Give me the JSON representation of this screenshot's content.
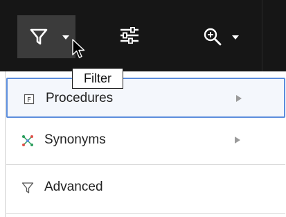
{
  "toolbar": {
    "buttons": [
      {
        "icon": "filter-icon",
        "has_dropdown": true,
        "selected": true
      },
      {
        "icon": "sliders-icon",
        "has_dropdown": false
      },
      {
        "icon": "zoom-icon",
        "has_dropdown": true
      }
    ],
    "background": "#161616",
    "selected_background": "#3b3b3b"
  },
  "tooltip": {
    "text": "Filter"
  },
  "menu": {
    "items": [
      {
        "label": "Procedures",
        "icon": "procedure-icon",
        "has_submenu": true,
        "highlighted": true
      },
      {
        "label": "Synonyms",
        "icon": "synonyms-icon",
        "has_submenu": true
      },
      {
        "label": "Advanced",
        "icon": "filter-outline-icon",
        "has_submenu": false
      }
    ],
    "highlight_border": "#5b8ddc"
  }
}
